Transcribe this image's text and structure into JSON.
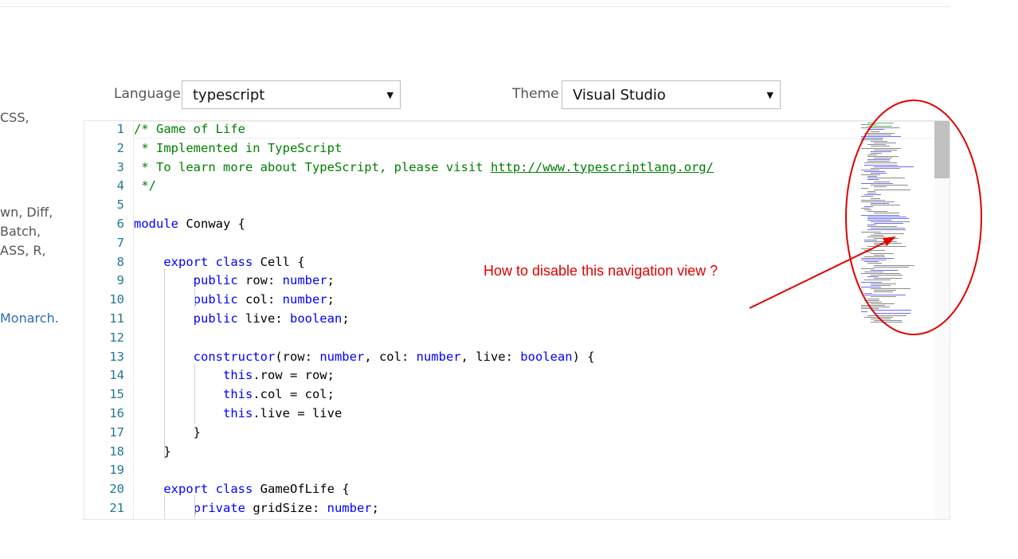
{
  "left_fragments": [
    {
      "text": "CSS,",
      "link": false
    },
    {
      "text": "wn, Diff,",
      "link": false
    },
    {
      "text": "Batch,",
      "link": false
    },
    {
      "text": "ASS, R,",
      "link": false
    },
    {
      "text": "Monarch.",
      "link": true
    }
  ],
  "controls": {
    "language_label": "Language",
    "language_value": "typescript",
    "theme_label": "Theme",
    "theme_value": "Visual Studio",
    "caret": "▼"
  },
  "editor": {
    "lines": [
      {
        "n": "1",
        "parts": [
          {
            "t": "/* Game of Life",
            "c": "cmt"
          }
        ]
      },
      {
        "n": "2",
        "parts": [
          {
            "t": " * Implemented in TypeScript",
            "c": "cmt"
          }
        ]
      },
      {
        "n": "3",
        "parts": [
          {
            "t": " * To learn more about TypeScript, please visit ",
            "c": "cmt"
          },
          {
            "t": "http://www.typescriptlang.org/",
            "c": "url"
          }
        ]
      },
      {
        "n": "4",
        "parts": [
          {
            "t": " */",
            "c": "cmt"
          }
        ]
      },
      {
        "n": "5",
        "parts": []
      },
      {
        "n": "6",
        "parts": [
          {
            "t": "module",
            "c": "kw"
          },
          {
            "t": " Conway {",
            "c": ""
          }
        ]
      },
      {
        "n": "7",
        "parts": []
      },
      {
        "n": "8",
        "parts": [
          {
            "t": "    ",
            "c": ""
          },
          {
            "t": "export",
            "c": "kw"
          },
          {
            "t": " ",
            "c": ""
          },
          {
            "t": "class",
            "c": "kw"
          },
          {
            "t": " Cell {",
            "c": ""
          }
        ]
      },
      {
        "n": "9",
        "parts": [
          {
            "t": "        ",
            "c": ""
          },
          {
            "t": "public",
            "c": "kw"
          },
          {
            "t": " row: ",
            "c": ""
          },
          {
            "t": "number",
            "c": "kw"
          },
          {
            "t": ";",
            "c": ""
          }
        ]
      },
      {
        "n": "10",
        "parts": [
          {
            "t": "        ",
            "c": ""
          },
          {
            "t": "public",
            "c": "kw"
          },
          {
            "t": " col: ",
            "c": ""
          },
          {
            "t": "number",
            "c": "kw"
          },
          {
            "t": ";",
            "c": ""
          }
        ]
      },
      {
        "n": "11",
        "parts": [
          {
            "t": "        ",
            "c": ""
          },
          {
            "t": "public",
            "c": "kw"
          },
          {
            "t": " live: ",
            "c": ""
          },
          {
            "t": "boolean",
            "c": "kw"
          },
          {
            "t": ";",
            "c": ""
          }
        ]
      },
      {
        "n": "12",
        "parts": []
      },
      {
        "n": "13",
        "parts": [
          {
            "t": "        ",
            "c": ""
          },
          {
            "t": "constructor",
            "c": "kw"
          },
          {
            "t": "(row: ",
            "c": ""
          },
          {
            "t": "number",
            "c": "kw"
          },
          {
            "t": ", col: ",
            "c": ""
          },
          {
            "t": "number",
            "c": "kw"
          },
          {
            "t": ", live: ",
            "c": ""
          },
          {
            "t": "boolean",
            "c": "kw"
          },
          {
            "t": ") {",
            "c": ""
          }
        ]
      },
      {
        "n": "14",
        "parts": [
          {
            "t": "            ",
            "c": ""
          },
          {
            "t": "this",
            "c": "kw"
          },
          {
            "t": ".row = row;",
            "c": ""
          }
        ]
      },
      {
        "n": "15",
        "parts": [
          {
            "t": "            ",
            "c": ""
          },
          {
            "t": "this",
            "c": "kw"
          },
          {
            "t": ".col = col;",
            "c": ""
          }
        ]
      },
      {
        "n": "16",
        "parts": [
          {
            "t": "            ",
            "c": ""
          },
          {
            "t": "this",
            "c": "kw"
          },
          {
            "t": ".live = live",
            "c": ""
          }
        ]
      },
      {
        "n": "17",
        "parts": [
          {
            "t": "        }",
            "c": ""
          }
        ]
      },
      {
        "n": "18",
        "parts": [
          {
            "t": "    }",
            "c": ""
          }
        ]
      },
      {
        "n": "19",
        "parts": []
      },
      {
        "n": "20",
        "parts": [
          {
            "t": "    ",
            "c": ""
          },
          {
            "t": "export",
            "c": "kw"
          },
          {
            "t": " ",
            "c": ""
          },
          {
            "t": "class",
            "c": "kw"
          },
          {
            "t": " GameOfLife {",
            "c": ""
          }
        ]
      },
      {
        "n": "21",
        "parts": [
          {
            "t": "        ",
            "c": ""
          },
          {
            "t": "private",
            "c": "kw"
          },
          {
            "t": " gridSize: ",
            "c": ""
          },
          {
            "t": "number",
            "c": "kw"
          },
          {
            "t": ";",
            "c": ""
          }
        ]
      }
    ]
  },
  "annotation": {
    "text": "How to disable this navigation view ?",
    "color": "#e00000"
  },
  "colors": {
    "comment": "#008000",
    "keyword": "#0000ff",
    "line_number": "#237893"
  }
}
